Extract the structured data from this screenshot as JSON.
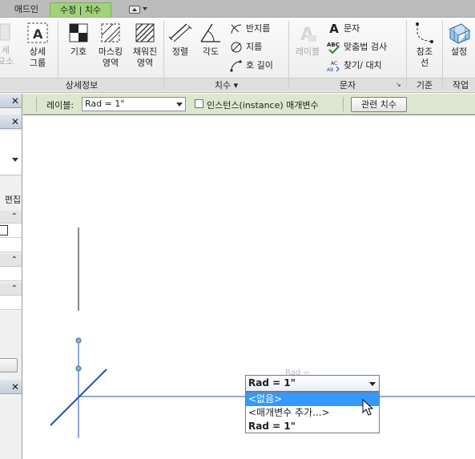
{
  "tabs": {
    "addin": "애드인",
    "modify": "수정 | 치수"
  },
  "ribbon": {
    "detail_panel": {
      "title": "상세정보",
      "partial_left": [
        "세",
        "요소"
      ],
      "detail_group": [
        "상세",
        "그룹"
      ],
      "symbol": "기호",
      "masking": [
        "마스킹",
        "영역"
      ],
      "filled": [
        "채워진",
        "영역"
      ]
    },
    "dimension_panel": {
      "title": "치수 ▾",
      "aligned": "정렬",
      "angular": "각도",
      "radial": "반지름",
      "diameter": "지름",
      "arc_length": "호 길이"
    },
    "text_panel": {
      "title": "문자",
      "label_tag": "레이블",
      "text": "문자",
      "spell": "맞춤법 검사",
      "find_replace": "찾기/ 대치"
    },
    "datum_panel": {
      "title": "기준",
      "ref_line": [
        "참조",
        "선"
      ]
    },
    "workplane_panel": {
      "title": "작업 ",
      "set": "설정"
    }
  },
  "options_bar": {
    "label_caption": "레이블:",
    "label_value": "Rad = 1\"",
    "instance_param": "인스턴스(instance) 매개변수",
    "related_dims": "관련 치수"
  },
  "left_panel": {
    "edit_partial": "편집"
  },
  "canvas": {
    "ghost_label": "Rad ="
  },
  "dropdown": {
    "current": "Rad = 1\"",
    "options": [
      "<없음>",
      "<매개변수 추가...>",
      "Rad = 1\""
    ],
    "selected_index": 0
  },
  "colors": {
    "tab_active": "#9fd37a",
    "options_bar": "#dbe8cf",
    "sketch_line": "#1f4fb0",
    "selection": "#3399ff"
  }
}
